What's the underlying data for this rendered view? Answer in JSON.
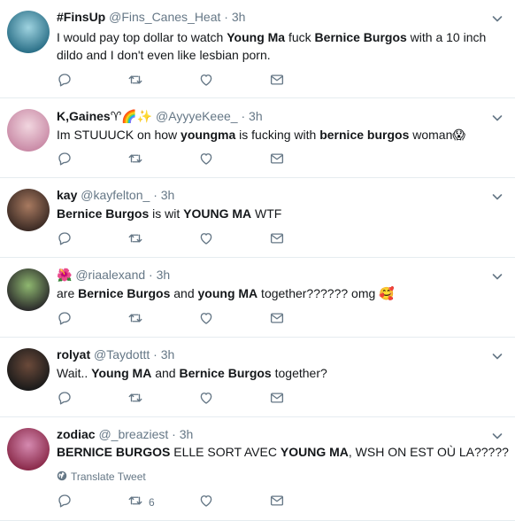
{
  "tweets": [
    {
      "name": "#FinsUp",
      "handle": "@Fins_Canes_Heat",
      "dot": "·",
      "time": "3h",
      "text_parts": [
        {
          "t": "I would pay top dollar to watch ",
          "b": false
        },
        {
          "t": "Young Ma",
          "b": true
        },
        {
          "t": " fuck ",
          "b": false
        },
        {
          "t": "Bernice Burgos",
          "b": true
        },
        {
          "t": " with a 10 inch",
          "b": false
        }
      ],
      "text_line2": "dildo and I don't even like lesbian porn.",
      "retweet_count": "",
      "avatar_colors": [
        "#2a6f87",
        "#9fd3e0"
      ]
    },
    {
      "name": "K,Gaines",
      "name_emoji": "♈🌈✨",
      "handle": "@AyyyeKeee_",
      "dot": "·",
      "time": "3h",
      "text_parts": [
        {
          "t": "Im STUUUCK on how ",
          "b": false
        },
        {
          "t": "youngma",
          "b": true
        },
        {
          "t": " is fucking with ",
          "b": false
        },
        {
          "t": "bernice burgos",
          "b": true
        },
        {
          "t": " woman",
          "b": false
        }
      ],
      "text_emoji": "😱",
      "retweet_count": "",
      "avatar_colors": [
        "#c98aa6",
        "#f1d6df"
      ]
    },
    {
      "name": "kay",
      "handle": "@kayfelton_",
      "dot": "·",
      "time": "3h",
      "text_parts": [
        {
          "t": "Bernice Burgos",
          "b": true
        },
        {
          "t": " is wit ",
          "b": false
        },
        {
          "t": "YOUNG MA",
          "b": true
        },
        {
          "t": " WTF",
          "b": false
        }
      ],
      "retweet_count": "",
      "avatar_colors": [
        "#3b2a24",
        "#a87a60"
      ]
    },
    {
      "name": "",
      "name_emoji": "🌺",
      "handle": "@riaalexand",
      "dot": "·",
      "time": "3h",
      "text_parts": [
        {
          "t": "are ",
          "b": false
        },
        {
          "t": "Bernice Burgos",
          "b": true
        },
        {
          "t": " and ",
          "b": false
        },
        {
          "t": "young MA",
          "b": true
        },
        {
          "t": " together?????? omg ",
          "b": false
        }
      ],
      "text_emoji": "🥰",
      "retweet_count": "",
      "avatar_colors": [
        "#2b2b2b",
        "#8fb870"
      ]
    },
    {
      "name": "rolyat",
      "handle": "@Taydottt",
      "dot": "·",
      "time": "3h",
      "text_parts": [
        {
          "t": "Wait.. ",
          "b": false
        },
        {
          "t": "Young MA",
          "b": true
        },
        {
          "t": " and ",
          "b": false
        },
        {
          "t": "Bernice Burgos",
          "b": true
        },
        {
          "t": " together?",
          "b": false
        }
      ],
      "retweet_count": "",
      "avatar_colors": [
        "#1a1a1a",
        "#6b4a3a"
      ]
    },
    {
      "name": "zodiac",
      "handle": "@_breaziest",
      "dot": "·",
      "time": "3h",
      "text_parts": [
        {
          "t": "BERNICE BURGOS",
          "b": true
        },
        {
          "t": " ELLE SORT AVEC ",
          "b": false
        },
        {
          "t": "YOUNG MA",
          "b": true
        },
        {
          "t": ", WSH ON EST OÙ LA?????",
          "b": false
        }
      ],
      "translate_label": "Translate Tweet",
      "retweet_count": "6",
      "avatar_colors": [
        "#8a2a4a",
        "#d58ab0"
      ]
    }
  ],
  "icons": {
    "reply": "reply-icon",
    "retweet": "retweet-icon",
    "like": "heart-icon",
    "dm": "envelope-icon",
    "caret": "chevron-down-icon",
    "globe": "globe-icon"
  },
  "colors": {
    "icon": "#657786",
    "text": "#14171a",
    "muted": "#657786",
    "divider": "#e6ecf0"
  }
}
